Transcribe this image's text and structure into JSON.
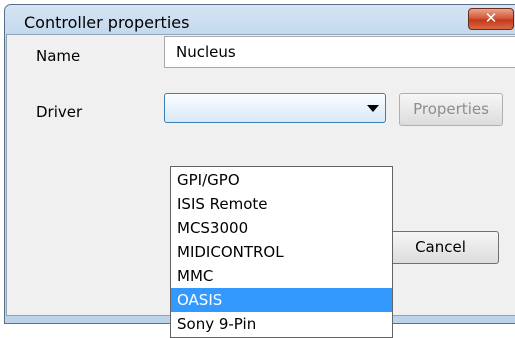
{
  "window": {
    "title": "Controller properties",
    "close_glyph": "✕"
  },
  "form": {
    "name_label": "Name",
    "name_value": "Nucleus",
    "driver_label": "Driver",
    "driver_value": ""
  },
  "buttons": {
    "properties": "Properties",
    "ok": "",
    "cancel": "Cancel"
  },
  "dropdown": {
    "selected_index": 5,
    "options": [
      "GPI/GPO",
      "ISIS Remote",
      "MCS3000",
      "MIDICONTROL",
      "MMC",
      "OASIS",
      "Sony 9-Pin"
    ]
  },
  "colors": {
    "selection": "#3399ff",
    "close_button": "#c3391b",
    "frame": "#bcd3ea"
  }
}
